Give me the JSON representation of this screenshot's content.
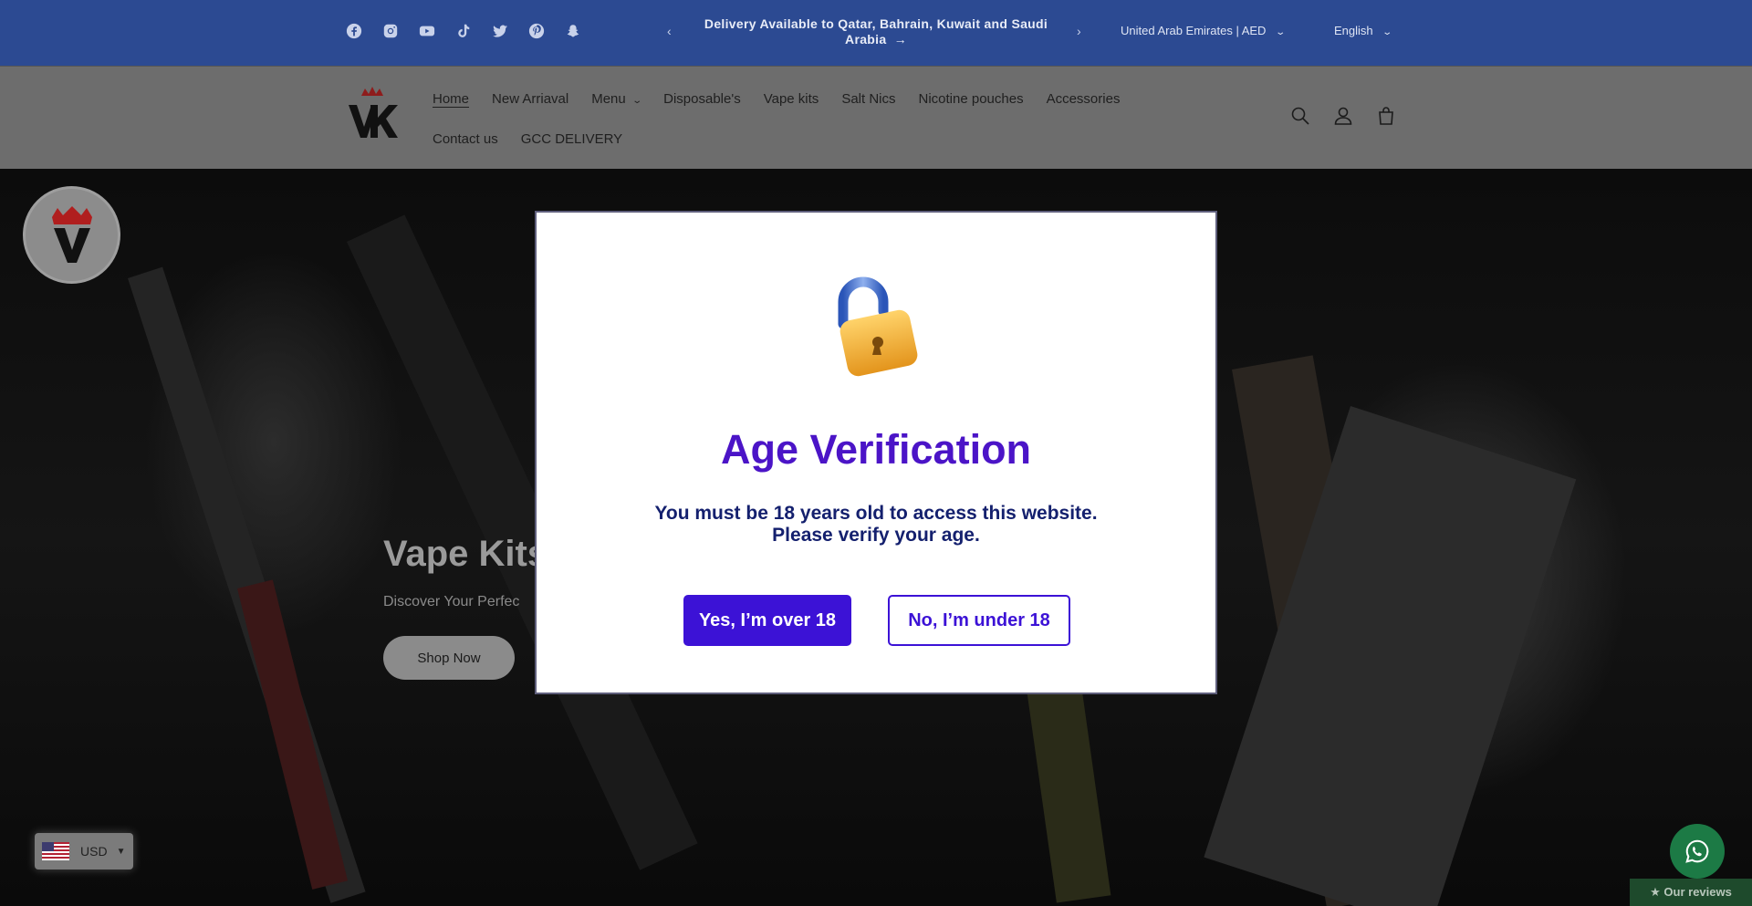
{
  "announcement": {
    "text": "Delivery Available to Qatar, Bahrain, Kuwait and Saudi Arabia",
    "arrow": "→",
    "prev": "‹",
    "next": "›"
  },
  "socials": [
    "facebook-icon",
    "instagram-icon",
    "youtube-icon",
    "tiktok-icon",
    "twitter-icon",
    "pinterest-icon",
    "snapchat-icon"
  ],
  "localization": {
    "country": "United Arab Emirates | AED",
    "language": "English"
  },
  "nav": {
    "items": [
      "Home",
      "New Arriaval",
      "Menu",
      "Disposable's",
      "Vape kits",
      "Salt Nics",
      "Nicotine pouches",
      "Accessories"
    ],
    "items_row2": [
      "Contact us",
      "GCC DELIVERY"
    ]
  },
  "hero": {
    "title": "Vape Kits",
    "subtitle": "Discover Your Perfec",
    "button": "Shop Now"
  },
  "modal": {
    "title": "Age Verification",
    "line1": "You must be 18 years old to access this website.",
    "line2": "Please verify your age.",
    "yes": "Yes, I’m over 18",
    "no": "No, I’m under 18"
  },
  "currency": {
    "code": "USD"
  },
  "reviews": {
    "label": "★ Our reviews"
  },
  "colors": {
    "topbar": "#2c4a92",
    "accent": "#3c12d6",
    "title": "#4b14c7",
    "whatsapp": "#1c7a45"
  }
}
